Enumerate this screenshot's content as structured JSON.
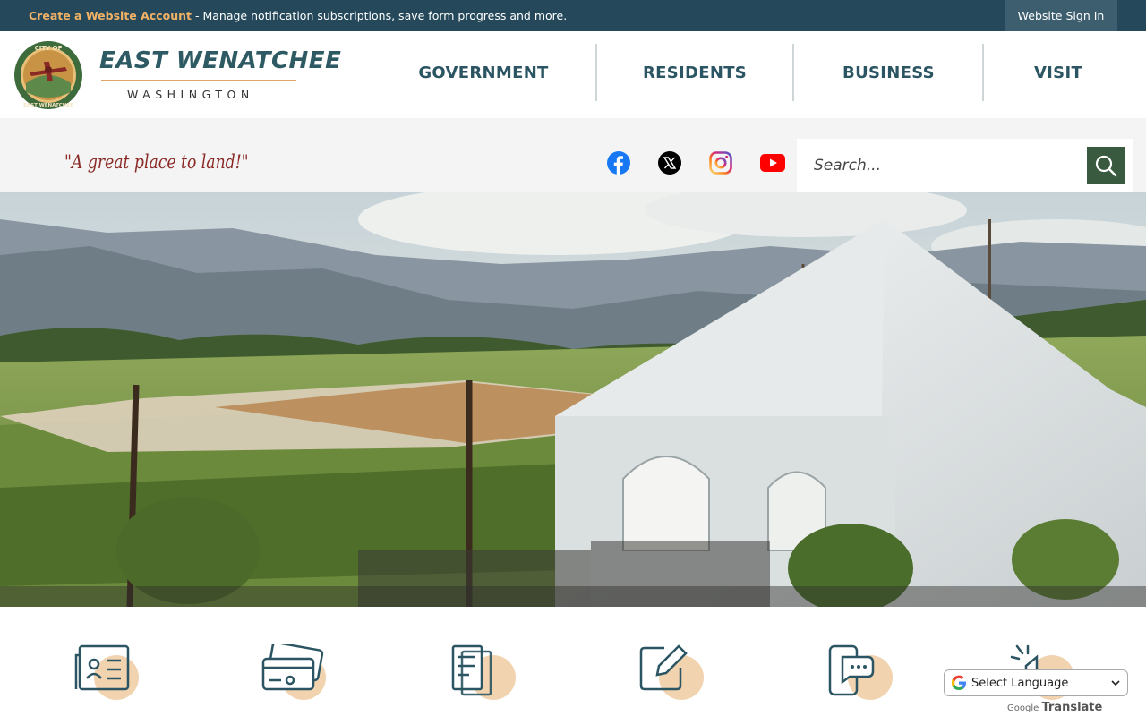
{
  "topbar": {
    "create_account_link": "Create a Website Account",
    "create_account_text": " - Manage notification subscriptions, save form progress and more.",
    "sign_in": "Website Sign In"
  },
  "logo": {
    "name": "EAST WENATCHEE",
    "subtitle": "WASHINGTON",
    "seal_text_top": "CITY OF",
    "seal_text_bottom": "EAST WENATCHEE"
  },
  "nav": {
    "items": [
      {
        "label": "GOVERNMENT"
      },
      {
        "label": "RESIDENTS"
      },
      {
        "label": "BUSINESS"
      },
      {
        "label": "VISIT"
      }
    ]
  },
  "subbar": {
    "tagline": "\"A great place to land!\"",
    "social_icons": [
      "facebook-icon",
      "x-twitter-icon",
      "instagram-icon",
      "youtube-icon"
    ]
  },
  "search": {
    "placeholder": "Search..."
  },
  "hero": {
    "description": "outdoor vineyard patio with white tent"
  },
  "quick_links": {
    "icons": [
      "news-icon",
      "payments-icon",
      "documents-icon",
      "forms-icon",
      "contact-icon",
      "notify-icon"
    ]
  },
  "translate": {
    "select_label": "Select Language",
    "powered_by": "Google",
    "translate_word": "Translate"
  },
  "colors": {
    "topbar": "#25495b",
    "accent": "#f2b266",
    "nav_text": "#2b5563",
    "search_button": "#3a5a3f",
    "tagline": "#8a2a26"
  }
}
